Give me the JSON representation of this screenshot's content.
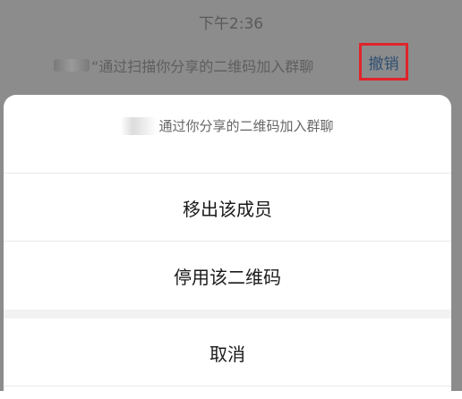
{
  "status": {
    "time": "下午2:36"
  },
  "notice": {
    "quote_text": "“通过扫描你分享的二维码加入群聊",
    "revoke_label": "撤销"
  },
  "sheet": {
    "description": "通过你分享的二维码加入群聊",
    "actions": [
      {
        "label": "移出该成员"
      },
      {
        "label": "停用该二维码"
      }
    ],
    "cancel_label": "取消"
  },
  "colors": {
    "overlay": "#8c8c8c",
    "link": "#2f4f72",
    "highlight_box": "#e0242a"
  }
}
